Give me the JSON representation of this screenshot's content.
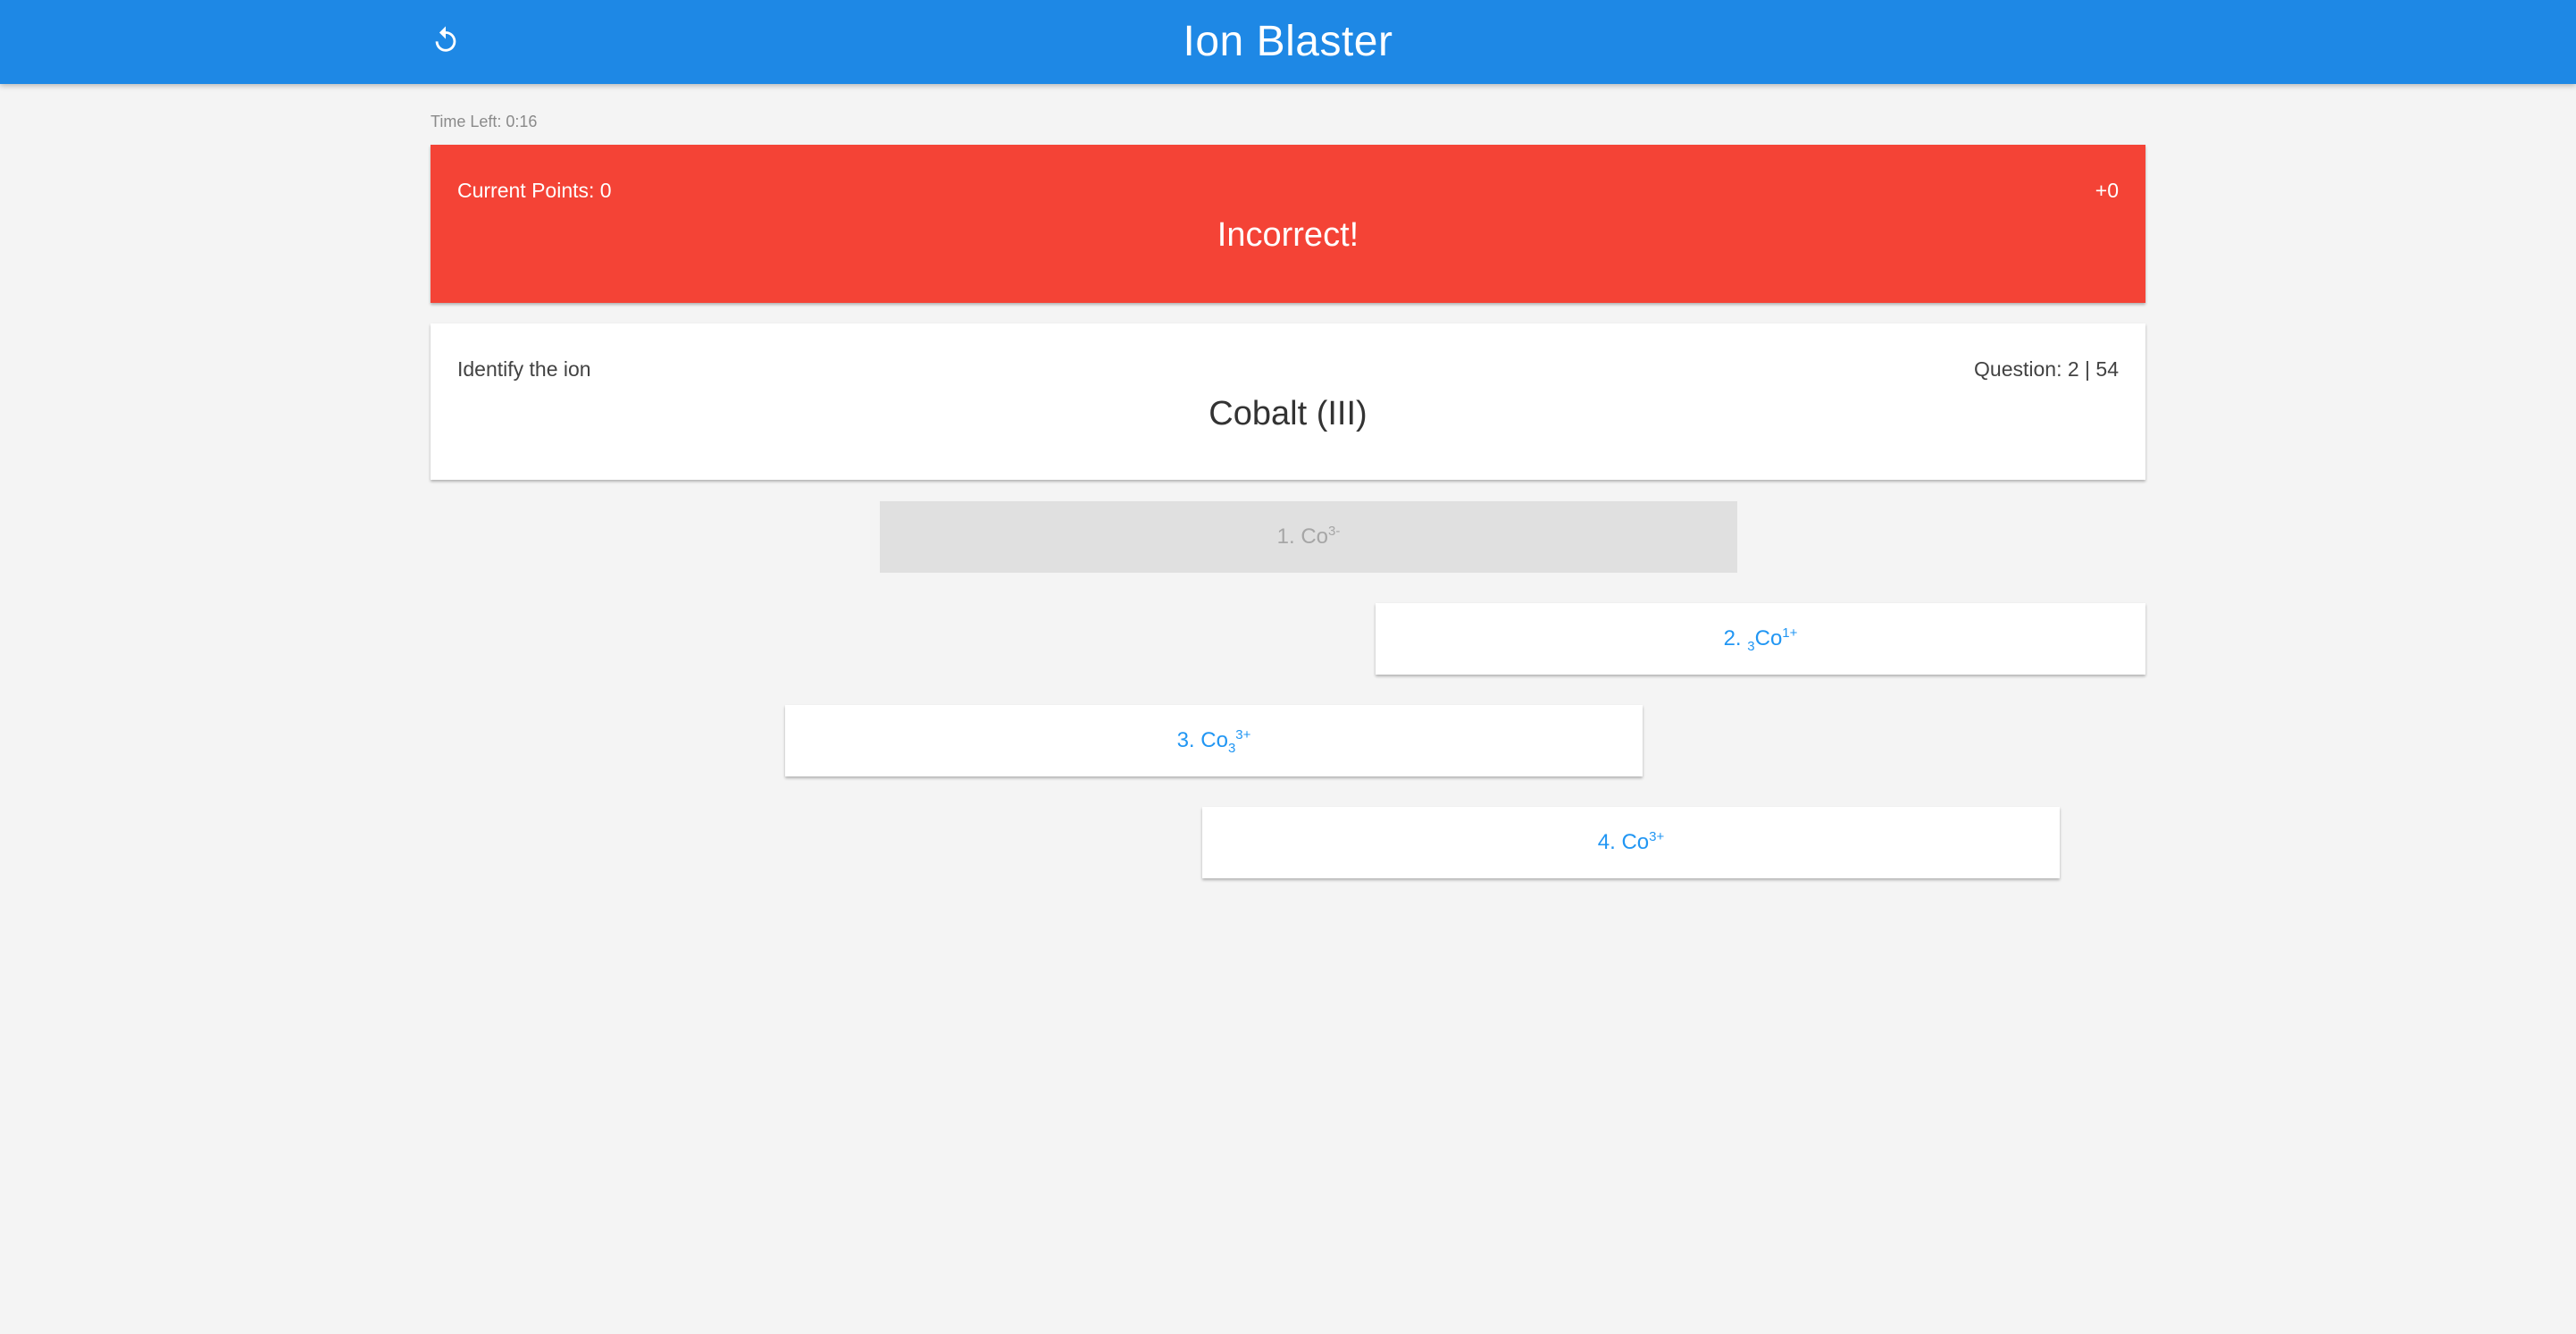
{
  "header": {
    "title": "Ion Blaster",
    "reset_icon": "refresh-icon",
    "bg_color": "#1e88e5"
  },
  "timer": {
    "text": "Time Left: 0:16"
  },
  "score_card": {
    "points_text": "Current Points: 0",
    "delta_text": "+0",
    "feedback": "Incorrect!",
    "bg_color": "#f44336"
  },
  "question_card": {
    "prompt": "Identify the ion",
    "counter": "Question: 2 | 54",
    "subject": "Cobalt (III)"
  },
  "answers": [
    {
      "prefix": "1. ",
      "pre_sub": "",
      "symbol": "Co",
      "sub": "",
      "sup": "3-",
      "disabled": true
    },
    {
      "prefix": "2. ",
      "pre_sub": "3",
      "symbol": "Co",
      "sub": "",
      "sup": "1+",
      "disabled": false
    },
    {
      "prefix": "3. ",
      "pre_sub": "",
      "symbol": "Co",
      "sub": "3",
      "sup": "3+",
      "disabled": false
    },
    {
      "prefix": "4. ",
      "pre_sub": "",
      "symbol": "Co",
      "sub": "",
      "sup": "3+",
      "disabled": false
    }
  ],
  "colors": {
    "answer_text": "#2196f3",
    "disabled_bg": "#e0e0e0",
    "disabled_text": "#a6a6a6"
  }
}
